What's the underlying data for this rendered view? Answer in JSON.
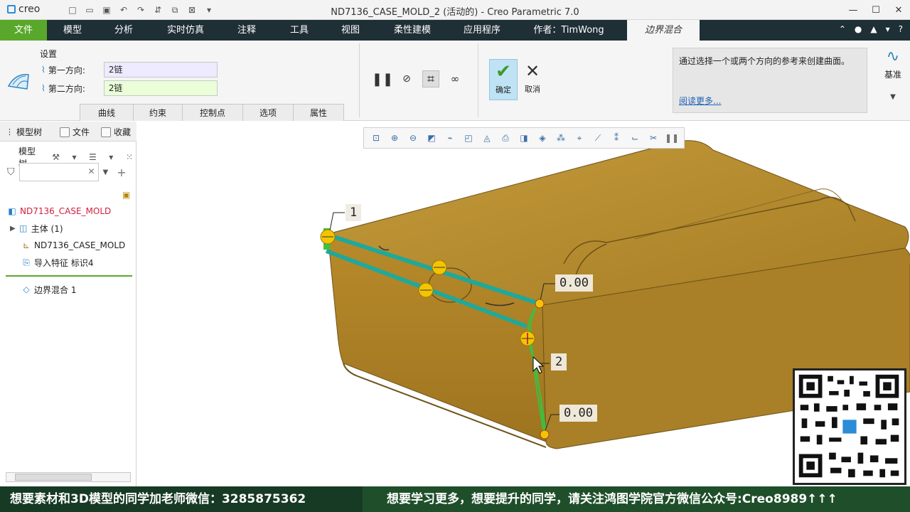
{
  "app": {
    "logo_text": "creo",
    "window_title": "ND7136_CASE_MOLD_2 (活动的) - Creo Parametric 7.0"
  },
  "tabs": [
    {
      "label": "文件"
    },
    {
      "label": "模型"
    },
    {
      "label": "分析"
    },
    {
      "label": "实时仿真"
    },
    {
      "label": "注释"
    },
    {
      "label": "工具"
    },
    {
      "label": "视图"
    },
    {
      "label": "柔性建模"
    },
    {
      "label": "应用程序"
    },
    {
      "label": "作者：TimWong"
    },
    {
      "label": "边界混合"
    }
  ],
  "ribbon": {
    "settings_title": "设置",
    "dir1_label": "第一方向:",
    "dir1_value": "2链",
    "dir2_label": "第二方向:",
    "dir2_value": "2链",
    "subtabs": [
      "曲线",
      "约束",
      "控制点",
      "选项",
      "属性"
    ],
    "ok_label": "确定",
    "cancel_label": "取消",
    "help_text": "通过选择一个或两个方向的参考来创建曲面。",
    "help_more": "阅读更多...",
    "datum_label": "基准"
  },
  "left_panel": {
    "tabs": [
      "模型树",
      "文件",
      "收藏"
    ],
    "tree_toolbar_label": "模型树",
    "filter_placeholder": "",
    "items": [
      {
        "label": "ND7136_CASE_MOLD",
        "icon": "part-icon"
      },
      {
        "label": "主体 (1)",
        "icon": "body-icon"
      },
      {
        "label": "ND7136_CASE_MOLD",
        "icon": "csys-icon"
      },
      {
        "label": "导入特征 标识4",
        "icon": "import-feature-icon"
      },
      {
        "label": "边界混合 1",
        "icon": "boundary-blend-icon"
      }
    ]
  },
  "graphics": {
    "dims": [
      "0.00",
      "2",
      "0.00"
    ],
    "curve_labels": [
      "1"
    ]
  },
  "banner": {
    "left": "想要素材和3D模型的同学加老师微信：3285875362",
    "right": "想要学习更多，想要提升的同学，请关注鸿图学院官方微信公众号:Creo8989↑↑↑"
  },
  "colors": {
    "tab_bar": "#1e2f36",
    "file_tab": "#5aa82b",
    "model": "#b3862a",
    "curve_teal": "#20a89a",
    "handle_yellow": "#f5c400"
  }
}
